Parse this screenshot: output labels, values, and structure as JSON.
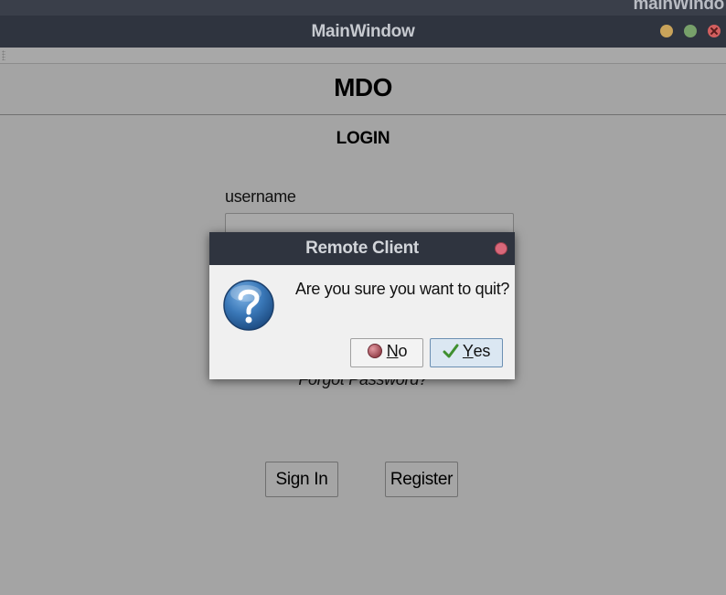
{
  "background_window": {
    "title": "mainWindo"
  },
  "window": {
    "title": "MainWindow"
  },
  "app": {
    "title": "MDO",
    "section_title": "LOGIN"
  },
  "login": {
    "username_label": "username",
    "username_value": "",
    "forgot_password": "Forgot Password?",
    "sign_in_label": "Sign In",
    "register_label": "Register"
  },
  "dialog": {
    "title": "Remote Client",
    "message": "Are you sure you want to quit?",
    "icon": "question-icon",
    "no_mnemonic": "N",
    "no_rest": "o",
    "yes_mnemonic": "Y",
    "yes_rest": "es"
  },
  "colors": {
    "titlebar": "#2f343f",
    "background": "#a4a4a4",
    "dialog_bg": "#f0f0f0",
    "close_red": "#d35f5f",
    "minimize_yellow": "#c9a35a",
    "maximize_green": "#77a06a",
    "default_button": "#dbe7f2"
  }
}
